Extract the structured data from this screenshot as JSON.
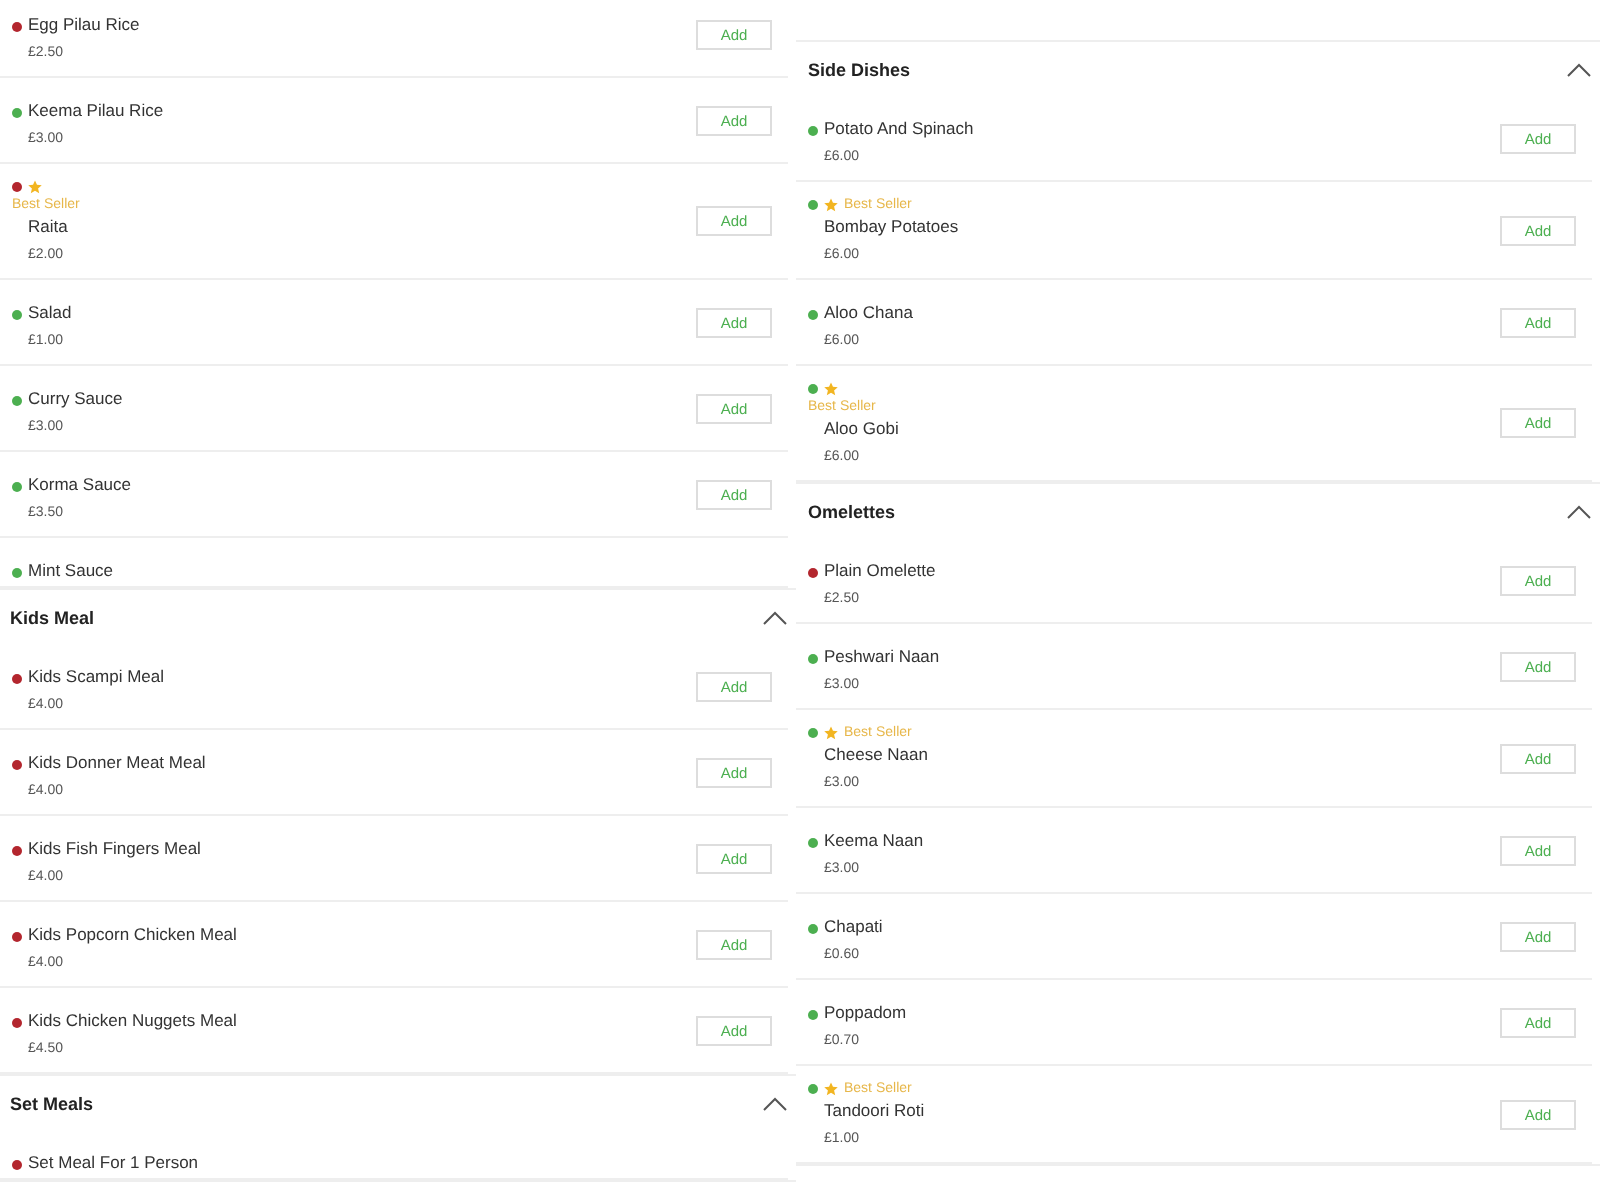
{
  "columns": [
    {
      "sections": [
        {
          "items": [
            {
              "name": "Egg Pilau Rice",
              "price": "£2.50",
              "color": "#b3262e",
              "kind": "plain",
              "button": "Add"
            },
            {
              "name": "Keema Pilau Rice",
              "price": "£3.00",
              "color": "#4caf50",
              "kind": "plain",
              "button": "Add"
            },
            {
              "name": "Raita",
              "price": "£2.00",
              "color": "#b3262e",
              "kind": "badge-stacked",
              "badge": "Best Seller",
              "button": "Add"
            },
            {
              "name": "Salad",
              "price": "£1.00",
              "color": "#4caf50",
              "kind": "plain",
              "button": "Add"
            },
            {
              "name": "Curry Sauce",
              "price": "£3.00",
              "color": "#4caf50",
              "kind": "plain",
              "button": "Add"
            },
            {
              "name": "Korma Sauce",
              "price": "£3.50",
              "color": "#4caf50",
              "kind": "plain",
              "button": "Add"
            },
            {
              "name": "Mint Sauce",
              "color": "#4caf50",
              "kind": "plain"
            }
          ]
        },
        {
          "title": "Kids Meal",
          "expanded": true,
          "items": [
            {
              "name": "Kids Scampi Meal",
              "price": "£4.00",
              "color": "#b3262e",
              "kind": "plain",
              "button": "Add"
            },
            {
              "name": "Kids Donner Meat Meal",
              "price": "£4.00",
              "color": "#b3262e",
              "kind": "plain",
              "button": "Add"
            },
            {
              "name": "Kids Fish Fingers Meal",
              "price": "£4.00",
              "color": "#b3262e",
              "kind": "plain",
              "button": "Add"
            },
            {
              "name": "Kids Popcorn Chicken Meal",
              "price": "£4.00",
              "color": "#b3262e",
              "kind": "plain",
              "button": "Add"
            },
            {
              "name": "Kids Chicken Nuggets Meal",
              "price": "£4.50",
              "color": "#b3262e",
              "kind": "plain",
              "button": "Add"
            }
          ]
        },
        {
          "title": "Set Meals",
          "expanded": true,
          "items": [
            {
              "name": "Set Meal For 1 Person",
              "color": "#b3262e",
              "kind": "plain"
            }
          ]
        }
      ]
    },
    {
      "sections": [
        {
          "title": "Side Dishes",
          "expanded": true,
          "items": [
            {
              "name": "Potato And Spinach",
              "price": "£6.00",
              "color": "#4caf50",
              "kind": "plain",
              "button": "Add"
            },
            {
              "name": "Bombay Potatoes",
              "price": "£6.00",
              "color": "#4caf50",
              "kind": "badge-inline",
              "badge": "Best Seller",
              "button": "Add"
            },
            {
              "name": "Aloo Chana",
              "price": "£6.00",
              "color": "#4caf50",
              "kind": "plain",
              "button": "Add"
            },
            {
              "name": "Aloo Gobi",
              "price": "£6.00",
              "color": "#4caf50",
              "kind": "badge-stacked",
              "badge": "Best Seller",
              "button": "Add"
            }
          ]
        },
        {
          "title": "Omelettes",
          "expanded": true,
          "items": [
            {
              "name": "Plain Omelette",
              "price": "£2.50",
              "color": "#b3262e",
              "kind": "plain",
              "button": "Add"
            },
            {
              "name": "Peshwari Naan",
              "price": "£3.00",
              "color": "#4caf50",
              "kind": "plain",
              "button": "Add"
            },
            {
              "name": "Cheese Naan",
              "price": "£3.00",
              "color": "#4caf50",
              "kind": "badge-inline",
              "badge": "Best Seller",
              "button": "Add"
            },
            {
              "name": "Keema Naan",
              "price": "£3.00",
              "color": "#4caf50",
              "kind": "plain",
              "button": "Add"
            },
            {
              "name": "Chapati",
              "price": "£0.60",
              "color": "#4caf50",
              "kind": "plain",
              "button": "Add"
            },
            {
              "name": "Poppadom",
              "price": "£0.70",
              "color": "#4caf50",
              "kind": "plain",
              "button": "Add"
            },
            {
              "name": "Tandoori Roti",
              "price": "£1.00",
              "color": "#4caf50",
              "kind": "badge-inline",
              "badge": "Best Seller",
              "button": "Add"
            }
          ]
        }
      ]
    }
  ]
}
